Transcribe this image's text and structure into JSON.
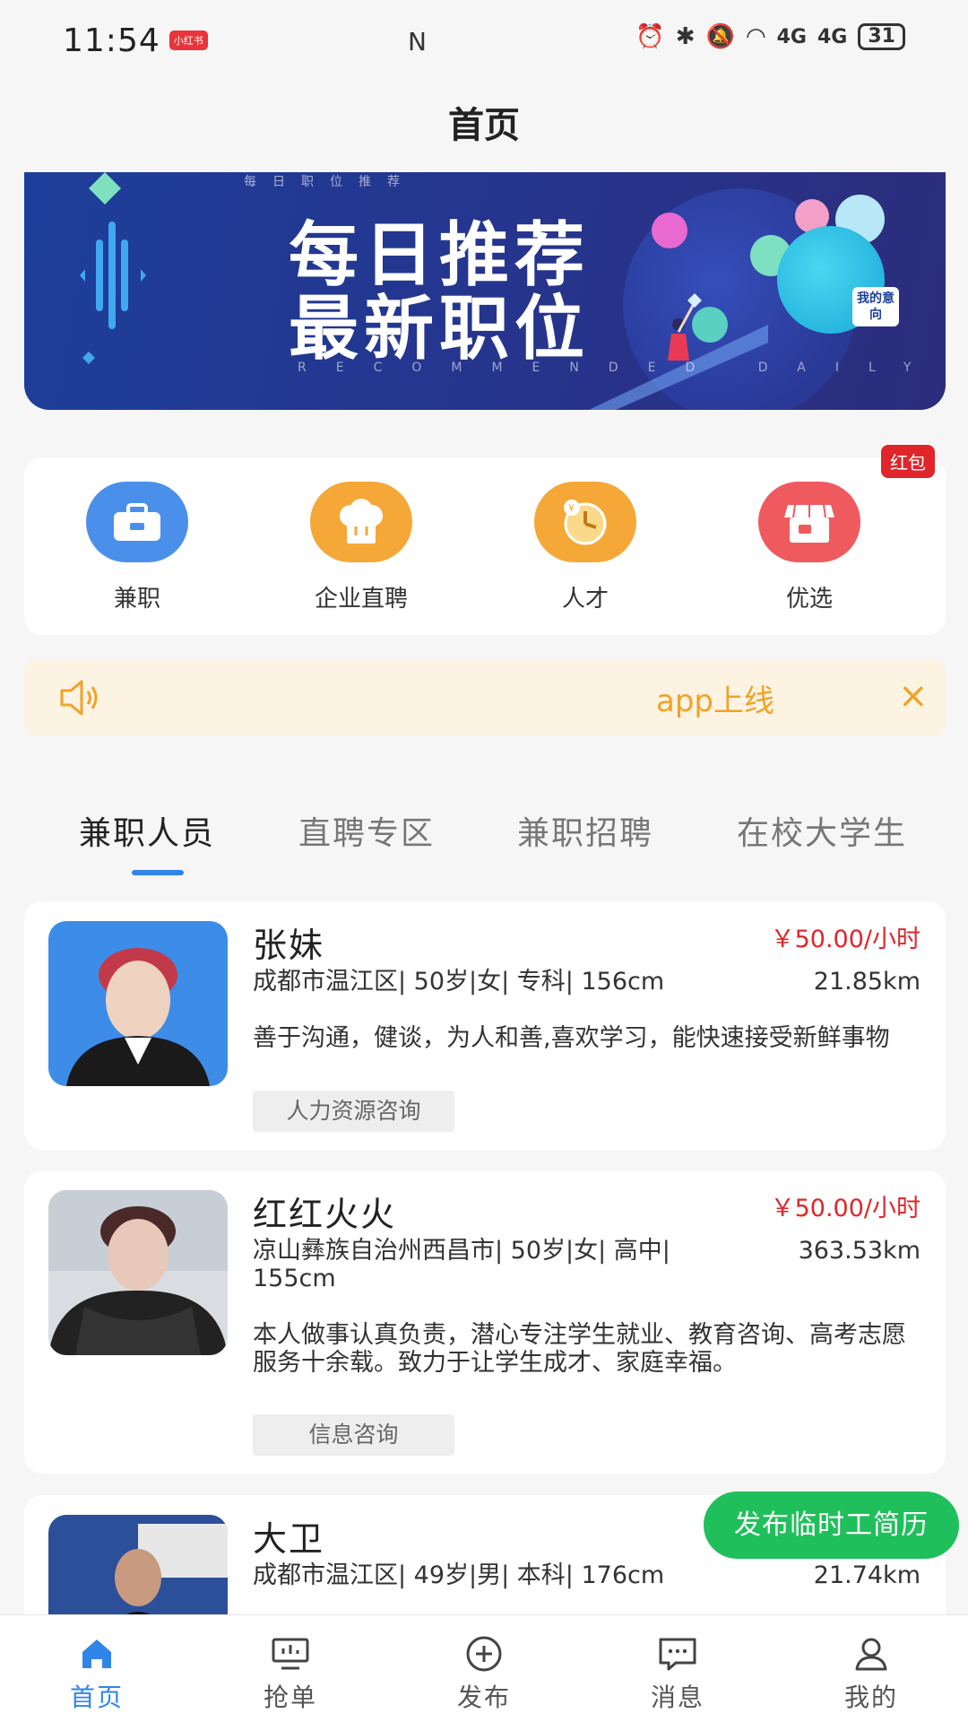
{
  "status": {
    "time": "11:54",
    "badge": "小红书",
    "nfc": "N",
    "sig1": "4G",
    "sig2": "4G",
    "battery": "31"
  },
  "header": {
    "title": "首页"
  },
  "banner": {
    "small": "每日职位推荐",
    "line1": "每日推荐",
    "line2": "最新职位",
    "en": "RECOMMENDED DAILY",
    "tag": "我的意向"
  },
  "categories": [
    {
      "label": "兼职",
      "icon": "briefcase-icon",
      "color": "#4a90ea"
    },
    {
      "label": "企业直聘",
      "icon": "chef-hat-icon",
      "color": "#f5a837"
    },
    {
      "label": "人才",
      "icon": "clock-icon",
      "color": "#f5a837"
    },
    {
      "label": "优选",
      "icon": "shop-icon",
      "color": "#ef5a5f"
    }
  ],
  "redpack": "红包",
  "notice": {
    "text": "app上线",
    "close": "×"
  },
  "tabs": [
    "兼职人员",
    "直聘专区",
    "兼职招聘",
    "在校大学生"
  ],
  "people": [
    {
      "name": "张妹",
      "wage": "￥50.00/小时",
      "info": "成都市温江区| 50岁|女| 专科| 156cm",
      "distance": "21.85km",
      "desc": "善于沟通，健谈，为人和善,喜欢学习，能快速接受新鲜事物",
      "tag": "人力资源咨询"
    },
    {
      "name": "红红火火",
      "wage": "￥50.00/小时",
      "info": "凉山彝族自治州西昌市| 50岁|女| 高中| 155cm",
      "distance": "363.53km",
      "desc": "本人做事认真负责，潜心专注学生就业、教育咨询、高考志愿服务十余载。致力于让学生成才、家庭幸福。",
      "tag": "信息咨询"
    },
    {
      "name": "大卫",
      "wage": "",
      "info": "成都市温江区| 49岁|男| 本科| 176cm",
      "distance": "21.74km",
      "desc": "",
      "tag": ""
    }
  ],
  "float_button": "发布临时工简历",
  "bottom_nav": [
    {
      "label": "首页",
      "icon": "home-icon",
      "active": true
    },
    {
      "label": "抢单",
      "icon": "monitor-icon",
      "active": false
    },
    {
      "label": "发布",
      "icon": "plus-circle-icon",
      "active": false
    },
    {
      "label": "消息",
      "icon": "message-icon",
      "active": false
    },
    {
      "label": "我的",
      "icon": "user-icon",
      "active": false
    }
  ],
  "colors": {
    "accent": "#2f86e8",
    "wage": "#e0252b",
    "notice": "#f0a327",
    "float": "#1fbf5b"
  }
}
